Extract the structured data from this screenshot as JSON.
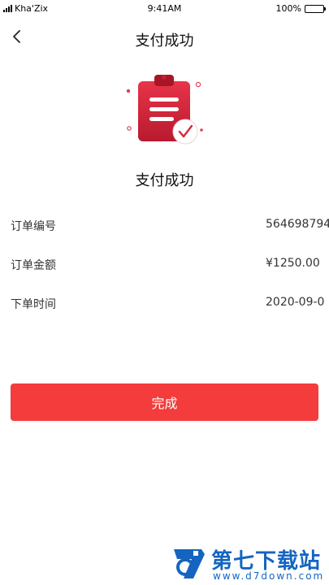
{
  "status_bar": {
    "carrier": "Kha'Zix",
    "time": "9:41AM",
    "battery": "100%",
    "battery_level": 1.0
  },
  "nav": {
    "back_icon": "chevron-left-icon",
    "title": "支付成功"
  },
  "hero": {
    "icon": "clipboard-check-icon",
    "status_text": "支付成功"
  },
  "order_info": [
    {
      "label": "订单编号",
      "value": "564698794"
    },
    {
      "label": "订单金额",
      "value": "¥1250.00"
    },
    {
      "label": "下单时间",
      "value": "2020-09-0"
    }
  ],
  "actions": {
    "done_label": "完成"
  },
  "watermark": {
    "site_name": "第七下载站",
    "url": "www.d7down.com"
  },
  "colors": {
    "accent": "#f43c3c",
    "icon_red": "#d8283c",
    "watermark_blue": "#1565c0"
  }
}
